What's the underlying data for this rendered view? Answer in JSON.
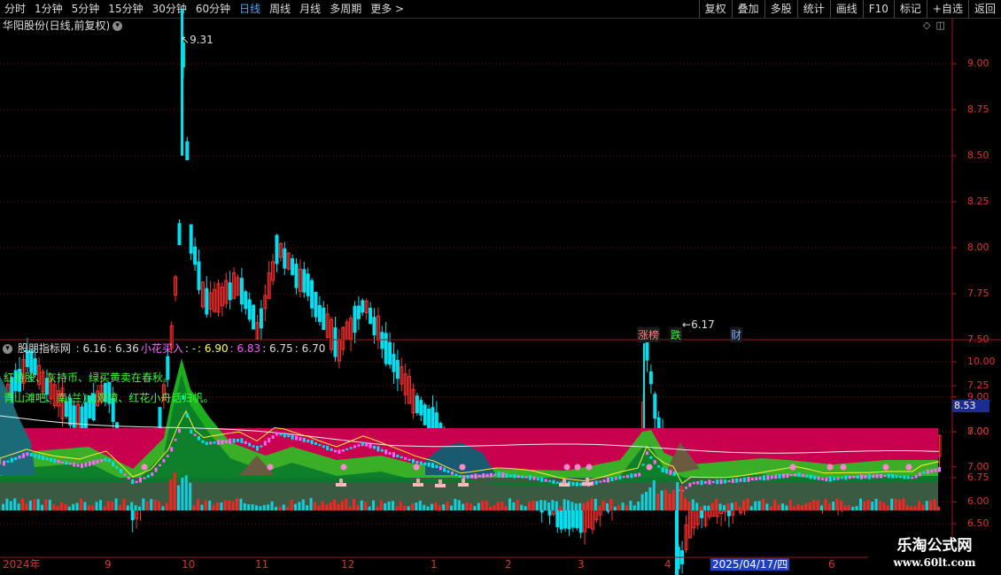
{
  "toolbar": {
    "timeframes": [
      "分时",
      "1分钟",
      "5分钟",
      "15分钟",
      "30分钟",
      "60分钟",
      "日线",
      "周线",
      "月线",
      "多周期",
      "更多 >"
    ],
    "active_timeframe": "日线",
    "tools": [
      "复权",
      "叠加",
      "多股",
      "统计",
      "画线",
      "F10",
      "标记",
      "+自选",
      "返回"
    ]
  },
  "main_panel": {
    "title": "华阳股份(日线,前复权)",
    "icons": [
      "diamond-icon",
      "layout-icon"
    ],
    "price_axis": [
      "9.00",
      "8.75",
      "8.50",
      "8.25",
      "8.00",
      "7.75",
      "7.50",
      "7.25",
      "7.00",
      "6.75",
      "6.50"
    ],
    "high_label": "9.31",
    "low_label": "6.17",
    "event_tags": [
      {
        "text": "涨榜",
        "color": "#ff8080"
      },
      {
        "text": "跌",
        "color": "#33ee33"
      },
      {
        "text": "财",
        "color": "#7aa8ff"
      }
    ]
  },
  "indicator_panel": {
    "name": "股朋指标网",
    "values": [
      {
        "text": ": 6.16",
        "color": "#dddddd"
      },
      {
        "text": ": 6.36",
        "color": "#dddddd"
      },
      {
        "text": "小花买入",
        "color": "#ff66ff"
      },
      {
        "text": ": -",
        "color": "#dddddd"
      },
      {
        "text": ": 6.90",
        "color": "#ffff55"
      },
      {
        "text": ": 6.83",
        "color": "#ff55ff"
      },
      {
        "text": ": 6.75",
        "color": "#dddddd"
      },
      {
        "text": ": 6.70",
        "color": "#dddddd"
      }
    ],
    "slogan_1": "红持股、灰持币、绿买黄卖在春秋。",
    "slogan_2": "青山滩吧、南(兰)山观墳、红花小舟话归帆。",
    "axis": [
      "10.00",
      "9.00",
      "8.00",
      "7.00",
      "6.00"
    ],
    "highlight_value": "8.53"
  },
  "date_axis": {
    "labels": [
      "2024年",
      "9",
      "10",
      "11",
      "12",
      "1",
      "2",
      "3",
      "4",
      "2025/04/17/四",
      "6"
    ],
    "cursor_label": "2025/04/17/四"
  },
  "watermark": {
    "line1": "乐淘公式网",
    "line2": "www.60lt.com"
  },
  "colors": {
    "up": "#ff3030",
    "down": "#00e0f0",
    "grid": "#7a1010",
    "panel_border": "#a01818"
  }
}
